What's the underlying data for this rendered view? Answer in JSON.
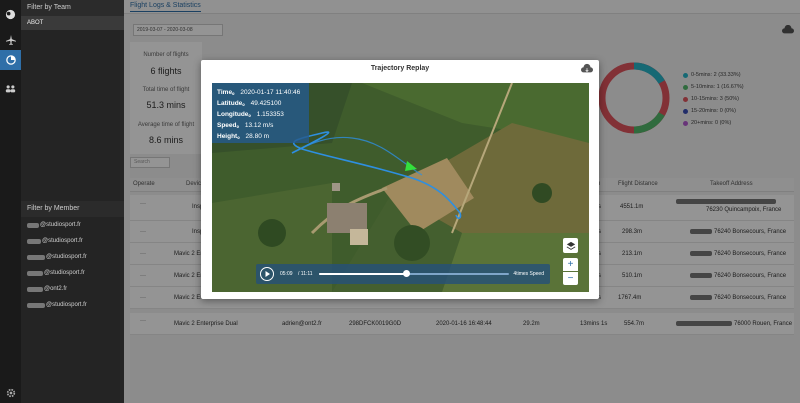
{
  "rail": {
    "icons": [
      "planet-icon",
      "airplane-icon",
      "dashboard-icon",
      "team-icon",
      "settings-icon"
    ]
  },
  "filter": {
    "team_header": "Filter by Team",
    "team_selected": "ABOT",
    "member_header": "Filter by Member",
    "members": [
      {
        "suffix": "@studiosport.fr"
      },
      {
        "suffix": "@studiosport.fr"
      },
      {
        "suffix": "@studiosport.fr"
      },
      {
        "suffix": "@studiosport.fr"
      },
      {
        "suffix": "@ont2.fr"
      },
      {
        "suffix": "@studiosport.fr"
      }
    ]
  },
  "main": {
    "tab": "Flight Logs & Statistics",
    "date_range": "2019-03-07 - 2020-03-08",
    "search_placeholder": "Search",
    "stats": {
      "flights_label": "Number of flights",
      "flights_value": "6 flights",
      "total_time_label": "Total time of flight",
      "total_time_value": "51.3 mins",
      "avg_time_label": "Average time of flight",
      "avg_time_value": "8.6 mins"
    },
    "legend": [
      {
        "label": "0-5mins: 2 (33.33%)",
        "color": "#26b5c8"
      },
      {
        "label": "5-10mins: 1 (16.67%)",
        "color": "#53b86b"
      },
      {
        "label": "10-15mins: 3 (50%)",
        "color": "#e0555e"
      },
      {
        "label": "15-20mins: 0 (0%)",
        "color": "#3a4fb5"
      },
      {
        "label": "20+mins: 0 (0%)",
        "color": "#b45bd1"
      }
    ],
    "columns": [
      "Operate",
      "Device",
      "n",
      "Flight Distance",
      "Takeoff Address"
    ],
    "rows": [
      {
        "operate": "···",
        "device": "Insp",
        "dur": "s",
        "distance": "4551.1m",
        "address": "76230 Quincampoix, France"
      },
      {
        "operate": "···",
        "device": "Insp",
        "dur": "s",
        "distance": "298.3m",
        "address": "76240 Bonsecours, France"
      },
      {
        "operate": "···",
        "device": "Mavic 2 En",
        "dur": "s",
        "distance": "213.1m",
        "address": "76240 Bonsecours, France"
      },
      {
        "operate": "···",
        "device": "Mavic 2 En",
        "dur": "s",
        "distance": "510.1m",
        "address": "76240 Bonsecours, France"
      },
      {
        "operate": "···",
        "device": "Mavic 2 En",
        "dur": "s",
        "distance": "1767.4m",
        "address": "76240 Bonsecours, France"
      },
      {
        "operate": "···",
        "device": "Mavic 2 Enterprise Dual",
        "member": "adrien@ont2.fr",
        "serial": "298DFCK0019G0D",
        "date": "2020-01-16 16:48:44",
        "height": "29.2m",
        "dur": "13mins 1s",
        "distance": "554.7m",
        "address": "76000 Rouen, France"
      }
    ]
  },
  "modal": {
    "title": "Trajectory Replay",
    "info": {
      "time_label": "Time。",
      "time_value": "2020-01-17 11:40:46",
      "lat_label": "Latitude。",
      "lat_value": "49.425100",
      "lon_label": "Longitude。",
      "lon_value": "1.153353",
      "speed_label": "Speed。",
      "speed_value": "13.12 m/s",
      "height_label": "Height。",
      "height_value": "28.80 m"
    },
    "player": {
      "current": "05:09",
      "total": "/ 11:11",
      "speed": "4times Speed",
      "progress": 0.46
    },
    "zoom_in": "+",
    "zoom_out": "−"
  }
}
